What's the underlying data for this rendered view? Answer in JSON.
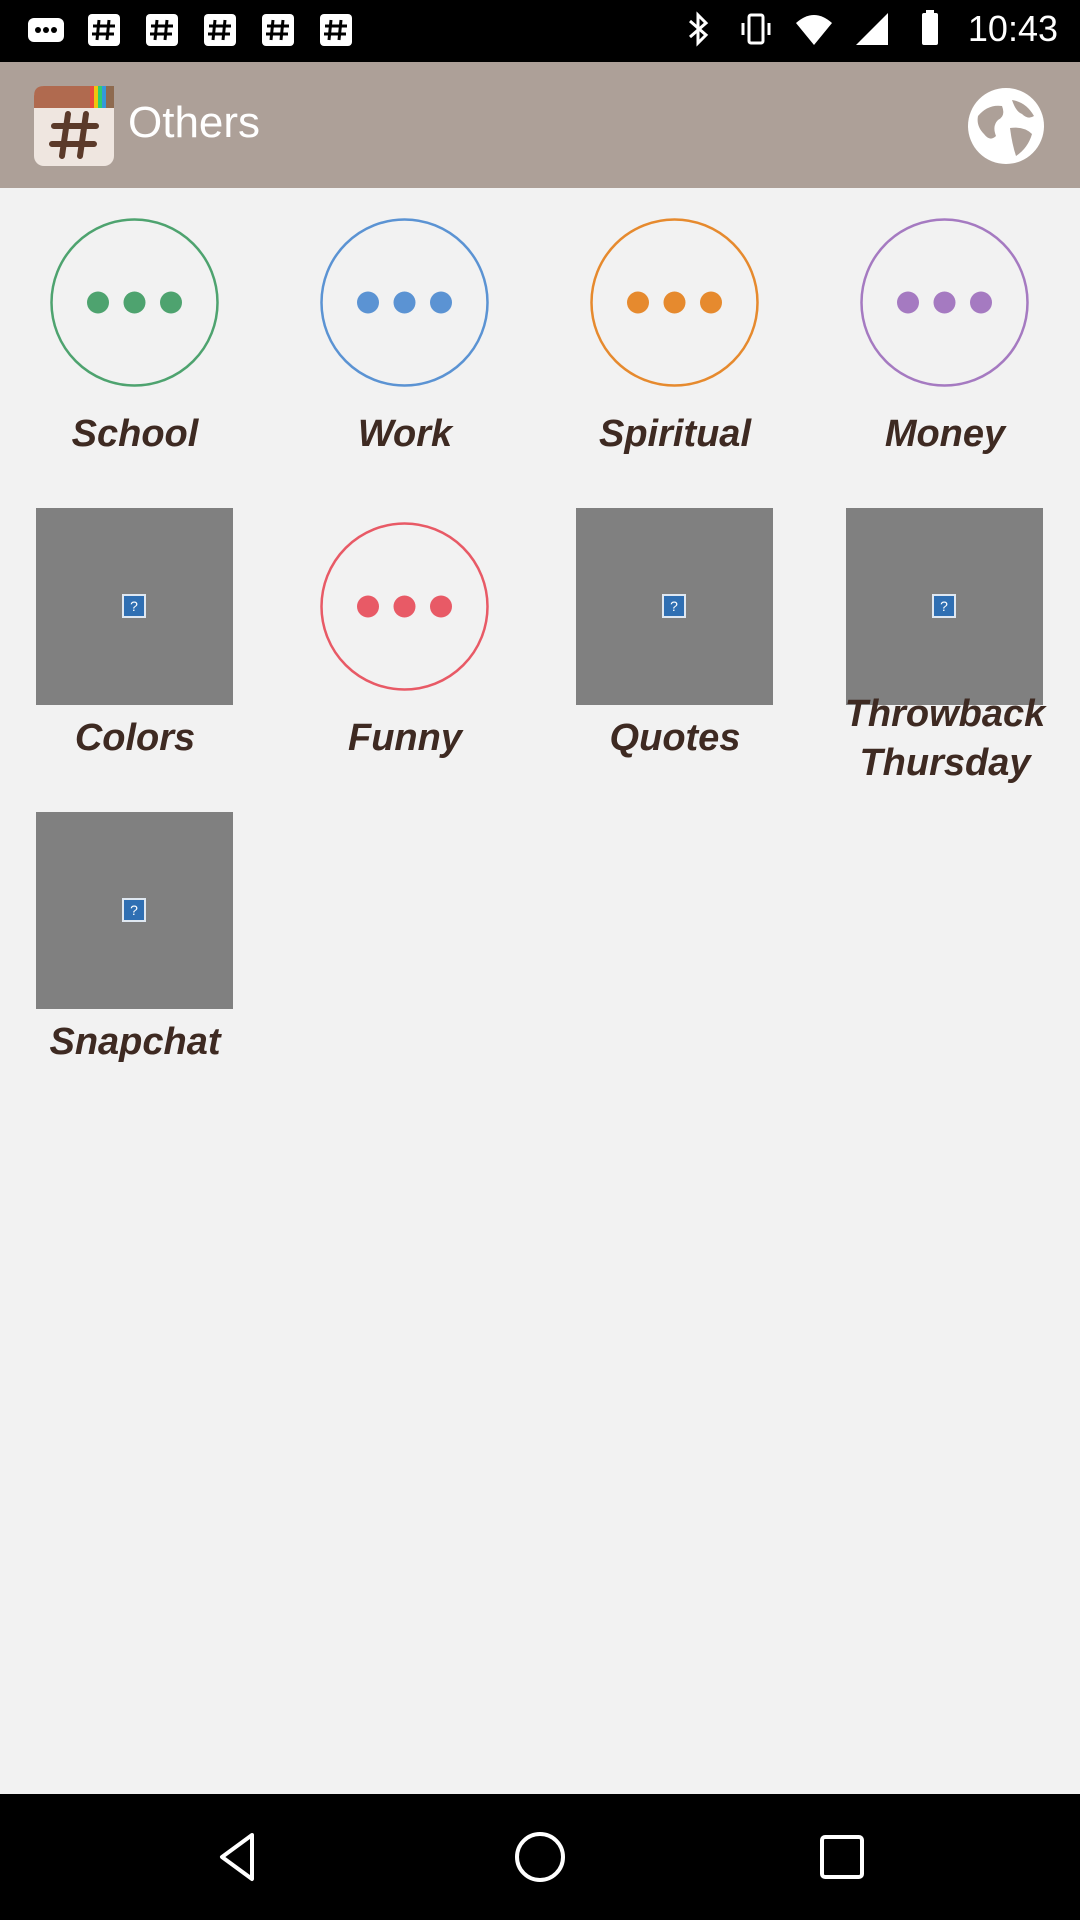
{
  "status_bar": {
    "time": "10:43"
  },
  "app_bar": {
    "title": "Others",
    "logo_icon": "hashtag-app-icon",
    "action_icon": "globe-icon"
  },
  "categories": [
    {
      "label": "School",
      "type": "circle",
      "color": "#4ea36f"
    },
    {
      "label": "Work",
      "type": "circle",
      "color": "#5b93d3"
    },
    {
      "label": "Spiritual",
      "type": "circle",
      "color": "#e68a2e"
    },
    {
      "label": "Money",
      "type": "circle",
      "color": "#a57ac1"
    },
    {
      "label": "Colors",
      "type": "image"
    },
    {
      "label": "Funny",
      "type": "circle",
      "color": "#e85a66"
    },
    {
      "label": "Quotes",
      "type": "image"
    },
    {
      "label": "Throwback\nThursday",
      "type": "image"
    },
    {
      "label": "Snapchat",
      "type": "image"
    }
  ],
  "colors": {
    "app_bar_bg": "#ada098",
    "background": "#f2f2f2",
    "label_text": "#3e2a22",
    "placeholder": "#808080"
  },
  "nav": {
    "back_icon": "back-triangle-icon",
    "home_icon": "home-circle-icon",
    "recents_icon": "recents-square-icon"
  }
}
